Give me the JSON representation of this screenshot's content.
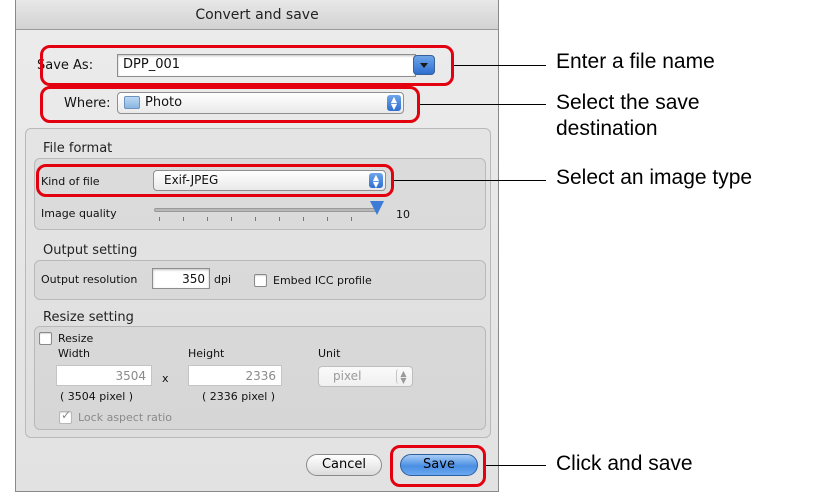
{
  "dialog": {
    "title": "Convert and save",
    "save_as_label": "Save As:",
    "save_as_value": "DPP_001",
    "where_label": "Where:",
    "where_value": "Photo",
    "file_format": {
      "title": "File format",
      "kind_label": "Kind of file",
      "kind_value": "Exif-JPEG",
      "quality_label": "Image quality",
      "quality_value": "10"
    },
    "output_setting": {
      "title": "Output setting",
      "resolution_label": "Output resolution",
      "resolution_value": "350",
      "resolution_unit": "dpi",
      "embed_icc_label": "Embed ICC profile"
    },
    "resize_setting": {
      "title": "Resize setting",
      "resize_label": "Resize",
      "width_label": "Width",
      "height_label": "Height",
      "unit_label": "Unit",
      "width_value": "3504",
      "height_value": "2336",
      "times_symbol": "x",
      "unit_value": "pixel",
      "width_pixels": "( 3504 pixel )",
      "height_pixels": "( 2336 pixel )",
      "lock_aspect_label": "Lock aspect ratio"
    },
    "cancel_label": "Cancel",
    "save_label": "Save"
  },
  "callouts": {
    "file_name": "Enter a file name",
    "destination": "Select the save\ndestination",
    "image_type": "Select an image type",
    "save": "Click and save"
  },
  "colors": {
    "highlight": "#e3000f",
    "default_button": "#4a8fe3"
  }
}
